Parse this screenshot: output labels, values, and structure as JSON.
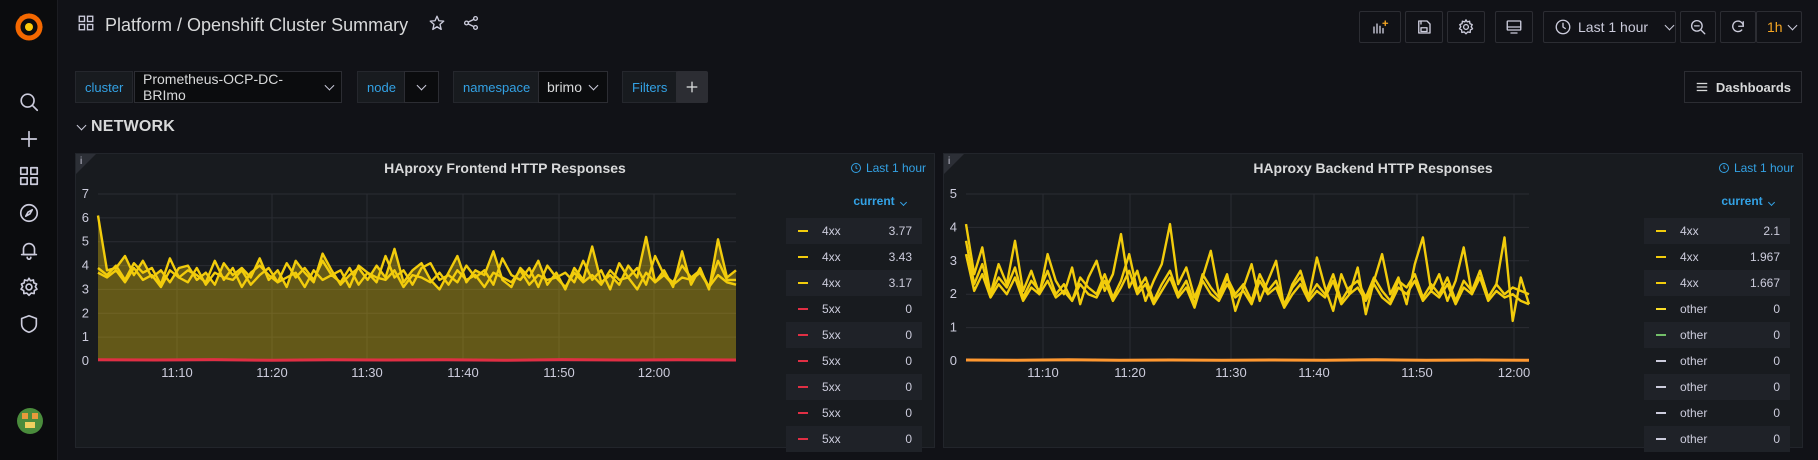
{
  "header": {
    "title": "Platform / Openshift Cluster Summary",
    "time_range": "Last 1 hour",
    "refresh_interval": "1h"
  },
  "variables": [
    {
      "label": "cluster",
      "value": "Prometheus-OCP-DC-BRImo"
    },
    {
      "label": "node",
      "value": ""
    },
    {
      "label": "namespace",
      "value": "brimo"
    },
    {
      "label": "Filters"
    }
  ],
  "dashboards_button": "Dashboards",
  "row": {
    "title": "NETWORK"
  },
  "panels": [
    {
      "title": "HAproxy Frontend HTTP Responses",
      "time_badge": "Last 1 hour",
      "legend_header": "current",
      "legend": [
        {
          "name": "4xx",
          "value": "3.77",
          "color": "#f2cc0c"
        },
        {
          "name": "4xx",
          "value": "3.43",
          "color": "#f2cc0c"
        },
        {
          "name": "4xx",
          "value": "3.17",
          "color": "#f2cc0c"
        },
        {
          "name": "5xx",
          "value": "0",
          "color": "#e02f44"
        },
        {
          "name": "5xx",
          "value": "0",
          "color": "#e02f44"
        },
        {
          "name": "5xx",
          "value": "0",
          "color": "#e02f44"
        },
        {
          "name": "5xx",
          "value": "0",
          "color": "#e02f44"
        },
        {
          "name": "5xx",
          "value": "0",
          "color": "#e02f44"
        },
        {
          "name": "5xx",
          "value": "0",
          "color": "#e02f44"
        }
      ]
    },
    {
      "title": "HAproxy Backend HTTP Responses",
      "time_badge": "Last 1 hour",
      "legend_header": "current",
      "legend": [
        {
          "name": "4xx",
          "value": "2.1",
          "color": "#f2cc0c"
        },
        {
          "name": "4xx",
          "value": "1.967",
          "color": "#f2cc0c"
        },
        {
          "name": "4xx",
          "value": "1.667",
          "color": "#f2cc0c"
        },
        {
          "name": "other",
          "value": "0",
          "color": "#fade2a"
        },
        {
          "name": "other",
          "value": "0",
          "color": "#73bf69"
        },
        {
          "name": "other",
          "value": "0",
          "color": "#ccccdc"
        },
        {
          "name": "other",
          "value": "0",
          "color": "#ccccdc"
        },
        {
          "name": "other",
          "value": "0",
          "color": "#ccccdc"
        },
        {
          "name": "other",
          "value": "0",
          "color": "#ccccdc"
        }
      ]
    }
  ],
  "chart_data": [
    {
      "type": "area",
      "title": "HAproxy Frontend HTTP Responses",
      "x_ticks": [
        "11:10",
        "11:20",
        "11:30",
        "11:40",
        "11:50",
        "12:00"
      ],
      "ylim": [
        0,
        7
      ],
      "y_ticks": [
        0,
        1,
        2,
        3,
        4,
        5,
        6,
        7
      ],
      "grid": true,
      "legend_placement": "right",
      "series": [
        {
          "name": "4xx",
          "color": "#f2cc0c",
          "values": [
            6.1,
            3.8,
            3.9,
            4.4,
            3.6,
            4.2,
            3.5,
            3.8,
            3.3,
            3.9,
            4.0,
            3.4,
            3.7,
            3.2,
            4.1,
            3.6,
            3.9,
            3.5,
            4.3,
            3.4,
            3.8,
            3.1,
            4.2,
            3.7,
            3.3,
            4.5,
            3.8,
            3.2,
            3.6,
            3.9,
            3.4,
            4.0,
            3.5,
            4.7,
            3.3,
            3.8,
            4.1,
            3.4,
            3.0,
            3.7,
            4.4,
            3.3,
            3.8,
            3.6,
            4.6,
            3.4,
            3.1,
            3.9,
            3.5,
            4.2,
            3.2,
            3.7,
            3.0,
            3.9,
            3.4,
            4.8,
            3.3,
            3.6,
            3.2,
            4.0,
            3.5,
            5.2,
            3.3,
            3.8,
            3.1,
            4.6,
            3.2,
            3.9,
            3.0,
            5.1,
            3.5,
            3.8
          ]
        },
        {
          "name": "4xx",
          "color": "#f2cc0c",
          "values": [
            3.9,
            3.6,
            4.0,
            3.4,
            4.1,
            3.7,
            3.9,
            3.2,
            4.3,
            3.5,
            3.8,
            3.6,
            3.3,
            4.2,
            3.4,
            3.9,
            3.1,
            3.7,
            4.0,
            3.6,
            3.3,
            4.1,
            3.5,
            3.9,
            3.4,
            4.2,
            3.6,
            3.8,
            3.1,
            4.0,
            3.7,
            3.3,
            4.4,
            3.5,
            3.8,
            3.2,
            3.9,
            4.1,
            3.4,
            3.6,
            3.3,
            4.0,
            3.5,
            3.8,
            3.2,
            4.3,
            3.6,
            3.4,
            3.9,
            3.1,
            4.0,
            3.5,
            3.7,
            3.3,
            4.2,
            3.4,
            3.8,
            3.0,
            4.1,
            3.5,
            3.9,
            3.2,
            4.4,
            3.6,
            3.3,
            4.0,
            3.5,
            3.8,
            3.1,
            4.2,
            3.4,
            3.4
          ]
        },
        {
          "name": "4xx",
          "color": "#f2cc0c",
          "values": [
            3.7,
            3.5,
            3.8,
            3.3,
            3.9,
            3.4,
            3.6,
            3.1,
            3.8,
            3.5,
            3.3,
            3.9,
            3.2,
            3.7,
            3.5,
            3.4,
            3.8,
            3.2,
            3.6,
            3.9,
            3.3,
            3.5,
            3.7,
            3.1,
            3.8,
            3.4,
            3.6,
            3.3,
            3.9,
            3.2,
            3.7,
            3.5,
            3.4,
            3.8,
            3.1,
            3.6,
            3.5,
            3.3,
            3.7,
            3.2,
            3.8,
            3.4,
            3.6,
            3.1,
            3.7,
            3.5,
            3.3,
            3.8,
            3.2,
            3.6,
            3.4,
            3.5,
            3.1,
            3.7,
            3.3,
            3.6,
            3.2,
            3.8,
            3.4,
            3.5,
            3.0,
            3.7,
            3.3,
            3.6,
            3.2,
            3.5,
            3.4,
            3.7,
            3.1,
            3.6,
            3.3,
            3.2
          ]
        },
        {
          "name": "5xx",
          "color": "#e02f44",
          "values": [
            0.05,
            0.04,
            0.06,
            0.03,
            0.05,
            0.04,
            0.05,
            0.03,
            0.06,
            0.04,
            0.05,
            0.04
          ]
        }
      ]
    },
    {
      "type": "line",
      "title": "HAproxy Backend HTTP Responses",
      "x_ticks": [
        "11:10",
        "11:20",
        "11:30",
        "11:40",
        "11:50",
        "12:00"
      ],
      "ylim": [
        0,
        5
      ],
      "y_ticks": [
        0,
        1,
        2,
        3,
        4,
        5
      ],
      "grid": true,
      "legend_placement": "right",
      "series": [
        {
          "name": "4xx",
          "color": "#f2cc0c",
          "values": [
            4.1,
            2.6,
            3.4,
            2.0,
            2.9,
            2.3,
            3.6,
            2.1,
            2.7,
            2.0,
            3.2,
            2.4,
            2.0,
            2.8,
            1.7,
            2.5,
            3.0,
            2.1,
            2.6,
            3.8,
            2.2,
            2.7,
            1.8,
            2.4,
            2.9,
            4.1,
            2.3,
            2.8,
            1.9,
            2.5,
            3.3,
            2.0,
            2.6,
            1.5,
            2.2,
            2.9,
            1.8,
            2.4,
            3.0,
            1.6,
            2.3,
            2.7,
            1.9,
            3.1,
            2.2,
            1.5,
            2.6,
            2.0,
            2.8,
            1.4,
            2.4,
            3.2,
            2.0,
            2.5,
            1.7,
            2.9,
            3.7,
            2.1,
            2.6,
            1.8,
            2.4,
            3.4,
            2.0,
            2.7,
            1.9,
            2.3,
            3.7,
            1.2,
            2.5,
            1.7
          ]
        },
        {
          "name": "4xx",
          "color": "#f2cc0c",
          "values": [
            3.6,
            2.3,
            2.9,
            2.0,
            2.5,
            2.2,
            2.8,
            1.9,
            2.4,
            2.1,
            2.7,
            2.0,
            2.3,
            1.8,
            2.5,
            2.2,
            2.0,
            2.6,
            1.9,
            2.4,
            3.2,
            2.1,
            2.5,
            1.8,
            2.3,
            2.7,
            2.0,
            2.4,
            1.7,
            2.6,
            2.2,
            1.9,
            2.5,
            2.0,
            2.3,
            1.8,
            2.6,
            2.1,
            2.4,
            1.7,
            2.2,
            2.5,
            1.9,
            2.3,
            2.0,
            2.6,
            1.8,
            2.2,
            2.4,
            1.9,
            2.5,
            2.1,
            1.8,
            2.4,
            2.2,
            2.6,
            1.9,
            2.3,
            2.0,
            2.5,
            1.8,
            2.4,
            2.1,
            2.7,
            1.9,
            2.3,
            2.0,
            2.2,
            2.1,
            2.0
          ]
        },
        {
          "name": "4xx",
          "color": "#f2cc0c",
          "values": [
            3.2,
            2.1,
            2.6,
            1.9,
            2.3,
            2.0,
            2.5,
            1.8,
            2.2,
            2.0,
            2.4,
            1.9,
            2.1,
            1.8,
            2.3,
            2.0,
            1.9,
            2.4,
            1.8,
            2.2,
            2.7,
            2.0,
            2.3,
            1.7,
            2.1,
            2.5,
            1.9,
            2.2,
            1.6,
            2.4,
            2.0,
            1.8,
            2.3,
            1.9,
            2.1,
            1.7,
            2.4,
            2.0,
            2.2,
            1.6,
            2.0,
            2.3,
            1.8,
            2.1,
            1.9,
            2.4,
            1.7,
            2.0,
            2.2,
            1.8,
            2.3,
            1.9,
            1.7,
            2.2,
            2.0,
            2.4,
            1.8,
            2.1,
            1.9,
            2.3,
            1.7,
            2.2,
            2.0,
            2.5,
            1.8,
            2.1,
            1.9,
            2.0,
            1.8,
            1.7
          ]
        },
        {
          "name": "other",
          "color": "#ff9830",
          "values": [
            0.03,
            0.02,
            0.04,
            0.02,
            0.03,
            0.02,
            0.03,
            0.02,
            0.04,
            0.02,
            0.03,
            0.02
          ]
        }
      ]
    }
  ]
}
